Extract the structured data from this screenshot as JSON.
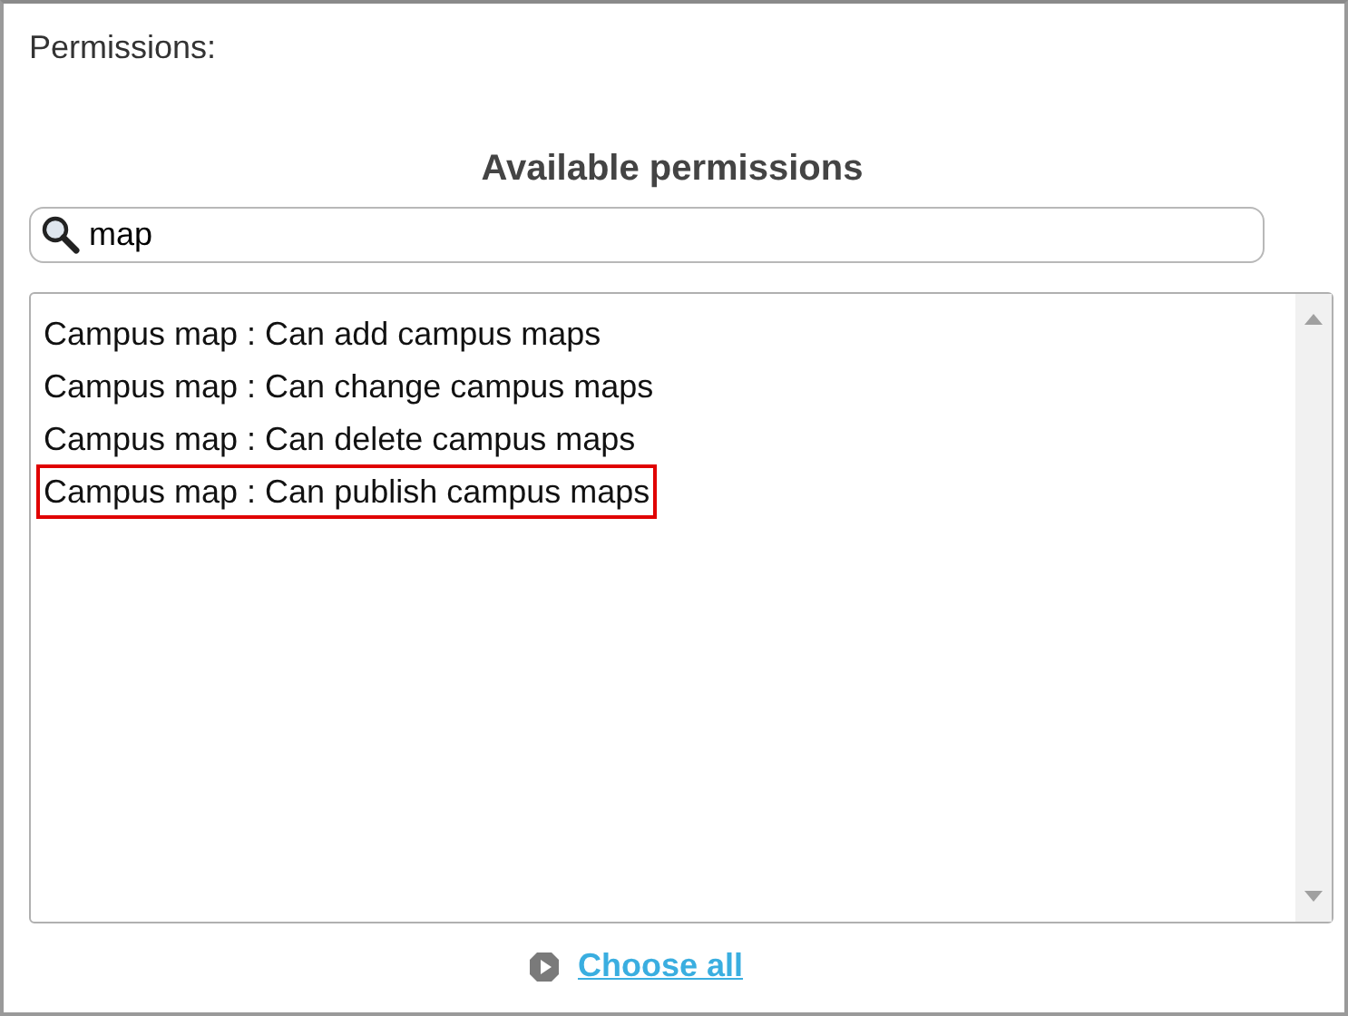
{
  "label": "Permissions:",
  "heading": "Available permissions",
  "search": {
    "value": "map"
  },
  "items": [
    {
      "text": "Campus map : Can add campus maps",
      "highlighted": false
    },
    {
      "text": "Campus map : Can change campus maps",
      "highlighted": false
    },
    {
      "text": "Campus map : Can delete campus maps",
      "highlighted": false
    },
    {
      "text": "Campus map : Can publish campus maps",
      "highlighted": true
    }
  ],
  "choose_all": "Choose all"
}
